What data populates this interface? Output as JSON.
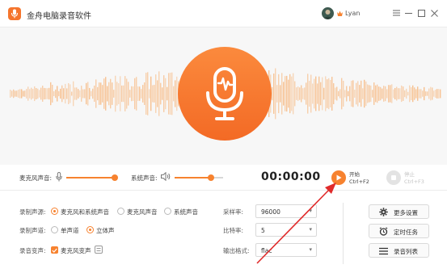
{
  "app": {
    "title": "金舟电脑录音软件",
    "accent": "#f7822f"
  },
  "user": {
    "name": "Lyan"
  },
  "controls": {
    "mic_label": "麦克风声音:",
    "mic_level": 0.95,
    "system_label": "系统声音:",
    "system_level": 0.75,
    "timer": "00:00:00",
    "start_label": "开始",
    "start_shortcut": "Ctrl+F2",
    "stop_label": "停止",
    "stop_shortcut": "Ctrl+F3"
  },
  "settings": {
    "source_label": "录制声源:",
    "source_options": [
      "麦克风和系统声音",
      "麦克风声音",
      "系统声音"
    ],
    "source_selected": 0,
    "channel_label": "录制声道:",
    "channel_options": [
      "单声道",
      "立体声"
    ],
    "channel_selected": 1,
    "voice_change_label": "录音变声:",
    "voice_change_option": "麦克风变声",
    "voice_change_checked": true,
    "sample_rate_label": "采样率:",
    "sample_rate_value": "96000",
    "bitrate_label": "比特率:",
    "bitrate_value": "5",
    "format_label": "输出格式:",
    "format_value": "flac"
  },
  "side_buttons": {
    "more_settings": "更多设置",
    "scheduled_task": "定时任务",
    "recording_list": "录音列表"
  }
}
